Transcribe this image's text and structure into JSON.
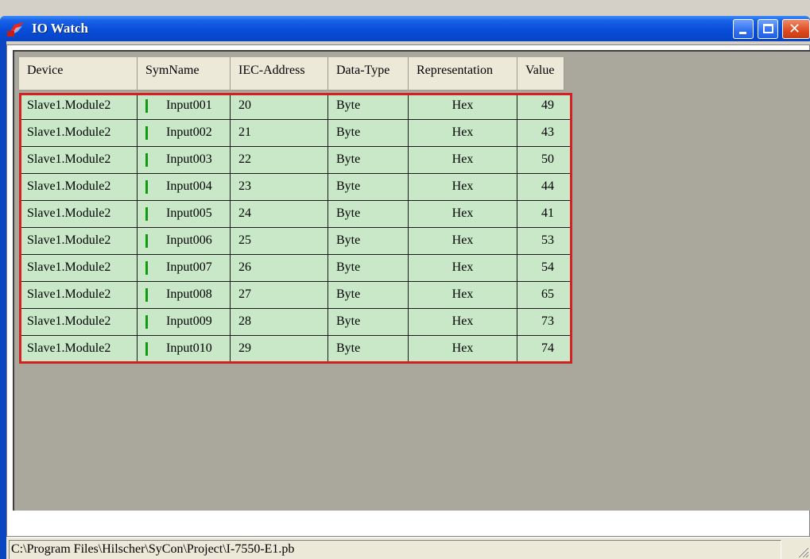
{
  "window": {
    "title": "IO Watch",
    "colors": {
      "titlebar": "#0a4fd9",
      "row_bg": "#c8e8c8",
      "selection_border": "#d42020",
      "status_indicator": "#139a13"
    }
  },
  "table": {
    "columns": [
      "Device",
      "SymName",
      "IEC-Address",
      "Data-Type",
      "Representation",
      "Value"
    ],
    "rows": [
      {
        "device": "Slave1.Module2",
        "symname": "Input001",
        "iec_address": "20",
        "data_type": "Byte",
        "representation": "Hex",
        "value": "49"
      },
      {
        "device": "Slave1.Module2",
        "symname": "Input002",
        "iec_address": "21",
        "data_type": "Byte",
        "representation": "Hex",
        "value": "43"
      },
      {
        "device": "Slave1.Module2",
        "symname": "Input003",
        "iec_address": "22",
        "data_type": "Byte",
        "representation": "Hex",
        "value": "50"
      },
      {
        "device": "Slave1.Module2",
        "symname": "Input004",
        "iec_address": "23",
        "data_type": "Byte",
        "representation": "Hex",
        "value": "44"
      },
      {
        "device": "Slave1.Module2",
        "symname": "Input005",
        "iec_address": "24",
        "data_type": "Byte",
        "representation": "Hex",
        "value": "41"
      },
      {
        "device": "Slave1.Module2",
        "symname": "Input006",
        "iec_address": "25",
        "data_type": "Byte",
        "representation": "Hex",
        "value": "53"
      },
      {
        "device": "Slave1.Module2",
        "symname": "Input007",
        "iec_address": "26",
        "data_type": "Byte",
        "representation": "Hex",
        "value": "54"
      },
      {
        "device": "Slave1.Module2",
        "symname": "Input008",
        "iec_address": "27",
        "data_type": "Byte",
        "representation": "Hex",
        "value": "65"
      },
      {
        "device": "Slave1.Module2",
        "symname": "Input009",
        "iec_address": "28",
        "data_type": "Byte",
        "representation": "Hex",
        "value": "73"
      },
      {
        "device": "Slave1.Module2",
        "symname": "Input010",
        "iec_address": "29",
        "data_type": "Byte",
        "representation": "Hex",
        "value": "74"
      }
    ]
  },
  "statusbar": {
    "path": "C:\\Program Files\\Hilscher\\SyCon\\Project\\I-7550-E1.pb"
  },
  "icons": {
    "app": "io-watch-app-icon",
    "minimize": "minimize-icon",
    "maximize": "maximize-icon",
    "close": "close-icon",
    "grip": "resize-grip-icon"
  }
}
